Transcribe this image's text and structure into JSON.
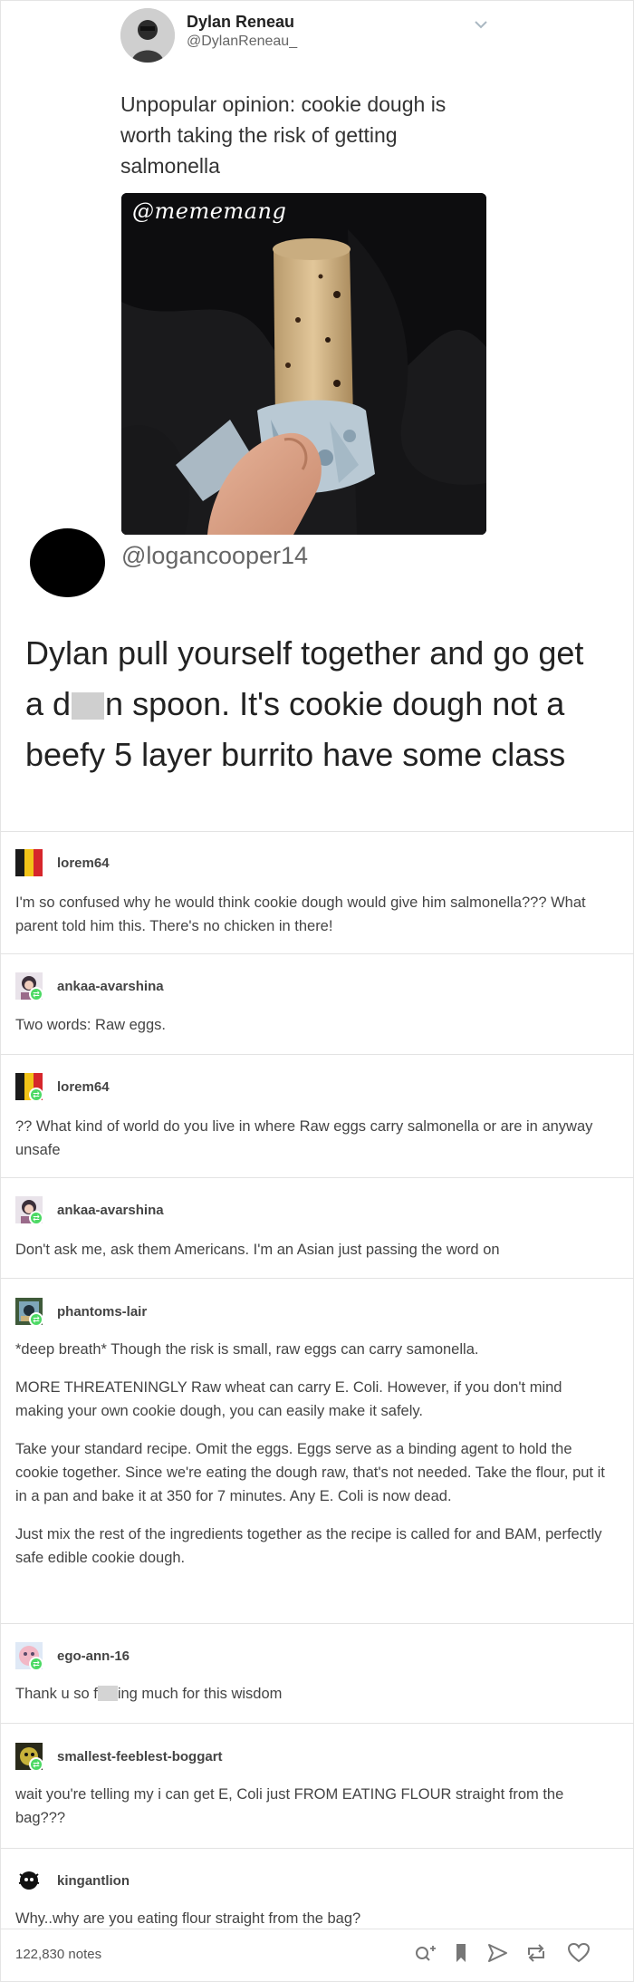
{
  "tweet": {
    "name": "Dylan Reneau",
    "handle": "@DylanReneau_",
    "text": "Unpopular opinion: cookie dough is worth taking the risk of getting salmonella",
    "image_watermark": "@mememang"
  },
  "reply": {
    "handle": "@logancooper14",
    "text_before": "Dylan pull yourself together and go get a d",
    "text_after": "n spoon. It's cookie dough not a beefy 5 layer burrito have some class"
  },
  "thread": [
    {
      "user": "lorem64",
      "paragraphs": [
        "I'm so confused why he would think cookie dough would give him salmonella??? What parent told him this. There's no chicken in there!"
      ]
    },
    {
      "user": "ankaa-avarshina",
      "paragraphs": [
        "Two words: Raw eggs."
      ]
    },
    {
      "user": "lorem64",
      "paragraphs": [
        "?? What kind of world do you live in where Raw eggs carry salmonella or are in anyway unsafe"
      ]
    },
    {
      "user": "ankaa-avarshina",
      "paragraphs": [
        "Don't ask me, ask them Americans. I'm an Asian just passing the word on"
      ]
    },
    {
      "user": "phantoms-lair",
      "paragraphs": [
        "*deep breath* Though the risk is small, raw eggs can carry samonella.",
        "MORE THREATENINGLY Raw wheat can carry E. Coli. However, if you don't mind making your own cookie dough, you can easily make it safely.",
        "Take your standard recipe. Omit the eggs. Eggs serve as a binding agent to hold the cookie together. Since we're eating the dough raw, that's not needed. Take the flour, put it in a pan and bake it at 350 for 7 minutes. Any E. Coli is now dead.",
        "Just mix the rest of the ingredients together as the recipe is called for and BAM, perfectly safe edible cookie dough."
      ]
    },
    {
      "user": "ego-ann-16",
      "text_before": "Thank u so f",
      "text_after": "ing much for this wisdom"
    },
    {
      "user": "smallest-feeblest-boggart",
      "paragraphs": [
        "wait you're telling my i can get E, Coli just FROM EATING FLOUR straight from the bag???"
      ]
    },
    {
      "user": "kingantlion",
      "paragraphs": [
        "Why..why are you eating flour straight from the bag?"
      ]
    }
  ],
  "footer": {
    "notes": "122,830 notes",
    "icons": [
      "search-icon",
      "bookmark-icon",
      "share-icon",
      "reblog-icon",
      "heart-icon"
    ]
  },
  "colors": {
    "badge": "#4cd964",
    "text": "#444444",
    "divider": "#e3e3e3"
  }
}
